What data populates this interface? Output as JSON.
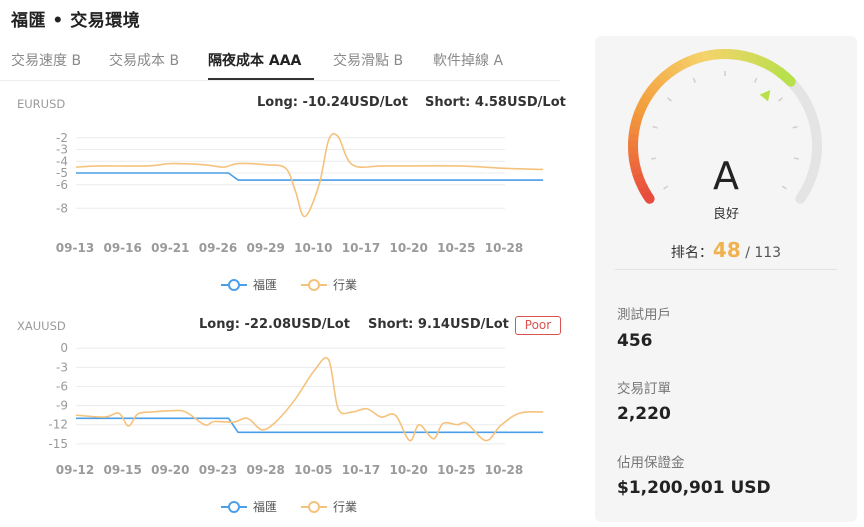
{
  "header": {
    "title": "福匯 • 交易環境"
  },
  "tabs": [
    {
      "label": "交易速度 B"
    },
    {
      "label": "交易成本 B"
    },
    {
      "label": "隔夜成本 AAA"
    },
    {
      "label": "交易滑點 B"
    },
    {
      "label": "軟件掉線 A"
    }
  ],
  "legend": {
    "series1": "福匯",
    "series2": "行業"
  },
  "colors": {
    "series1": "#4a9fe8",
    "series2": "#f5c27d",
    "gauge_red": "#e84c3d",
    "gauge_orange": "#f39c3c",
    "gauge_yellow": "#f5d36b",
    "gauge_green": "#b7e04b",
    "rank_accent": "#f0b24e",
    "poor": "#d9534f"
  },
  "eurusd": {
    "symbol": "EURUSD",
    "long": "Long: -10.24USD/Lot",
    "short": "Short: 4.58USD/Lot"
  },
  "xauusd": {
    "symbol": "XAUUSD",
    "long": "Long: -22.08USD/Lot",
    "short": "Short: 9.14USD/Lot",
    "badge": "Poor"
  },
  "chart_data": [
    {
      "type": "line",
      "title": "EURUSD",
      "x": [
        "09-13",
        "09-16",
        "09-21",
        "09-26",
        "09-29",
        "10-10",
        "10-17",
        "10-20",
        "10-25",
        "10-28"
      ],
      "ylim": [
        -9,
        -1
      ],
      "yticks": [
        "-2",
        "-3",
        "-4",
        "-5",
        "-6",
        "-8"
      ],
      "series": [
        {
          "name": "福匯",
          "x": [
            0,
            3.2,
            3.4,
            9.8
          ],
          "values": [
            -5.0,
            -5.0,
            -5.6,
            -5.6
          ]
        },
        {
          "name": "行業",
          "x": [
            0,
            0.5,
            1.5,
            2.0,
            2.7,
            3.1,
            3.4,
            4.0,
            4.4,
            4.6,
            4.8,
            5.1,
            5.3,
            5.5,
            5.8,
            6.5,
            8.0,
            9.0,
            9.8
          ],
          "values": [
            -4.5,
            -4.4,
            -4.4,
            -4.2,
            -4.3,
            -4.5,
            -4.2,
            -4.3,
            -4.6,
            -6.5,
            -8.7,
            -6.0,
            -2.2,
            -1.9,
            -4.3,
            -4.4,
            -4.4,
            -4.6,
            -4.7
          ]
        }
      ]
    },
    {
      "type": "line",
      "title": "XAUUSD",
      "x": [
        "09-12",
        "09-15",
        "09-20",
        "09-23",
        "09-28",
        "10-05",
        "10-17",
        "10-20",
        "10-25",
        "10-28"
      ],
      "ylim": [
        -15.5,
        0.5
      ],
      "yticks": [
        "0",
        "-3",
        "-6",
        "-9",
        "-12",
        "-15"
      ],
      "series": [
        {
          "name": "福匯",
          "x": [
            0,
            3.2,
            3.4,
            9.8
          ],
          "values": [
            -11.0,
            -11.0,
            -13.2,
            -13.2
          ]
        },
        {
          "name": "行業",
          "x": [
            0,
            0.6,
            0.9,
            1.1,
            1.3,
            1.6,
            2.0,
            2.3,
            2.7,
            2.9,
            3.3,
            3.6,
            3.9,
            4.2,
            4.6,
            5.0,
            5.3,
            5.5,
            5.8,
            6.1,
            6.4,
            6.7,
            7.0,
            7.2,
            7.5,
            7.7,
            8.0,
            8.2,
            8.6,
            8.9,
            9.3,
            9.8
          ],
          "values": [
            -10.5,
            -10.8,
            -10.2,
            -12.2,
            -10.3,
            -10.0,
            -9.8,
            -10.0,
            -12.0,
            -11.5,
            -11.6,
            -11.0,
            -12.8,
            -11.5,
            -8.0,
            -3.5,
            -1.8,
            -9.5,
            -10.0,
            -9.5,
            -10.8,
            -10.5,
            -14.5,
            -12.0,
            -14.2,
            -11.8,
            -12.0,
            -11.8,
            -14.5,
            -12.2,
            -10.2,
            -10.0
          ]
        }
      ]
    }
  ],
  "score": {
    "grade": "A",
    "grade_text": "良好",
    "rank_label": "排名：",
    "rank_value": "48",
    "rank_total": "/ 113",
    "gauge_level": 0.68
  },
  "stats": [
    {
      "label": "測試用戶",
      "value": "456"
    },
    {
      "label": "交易訂單",
      "value": "2,220"
    },
    {
      "label": "佔用保證金",
      "value": "$1,200,901 USD"
    }
  ]
}
